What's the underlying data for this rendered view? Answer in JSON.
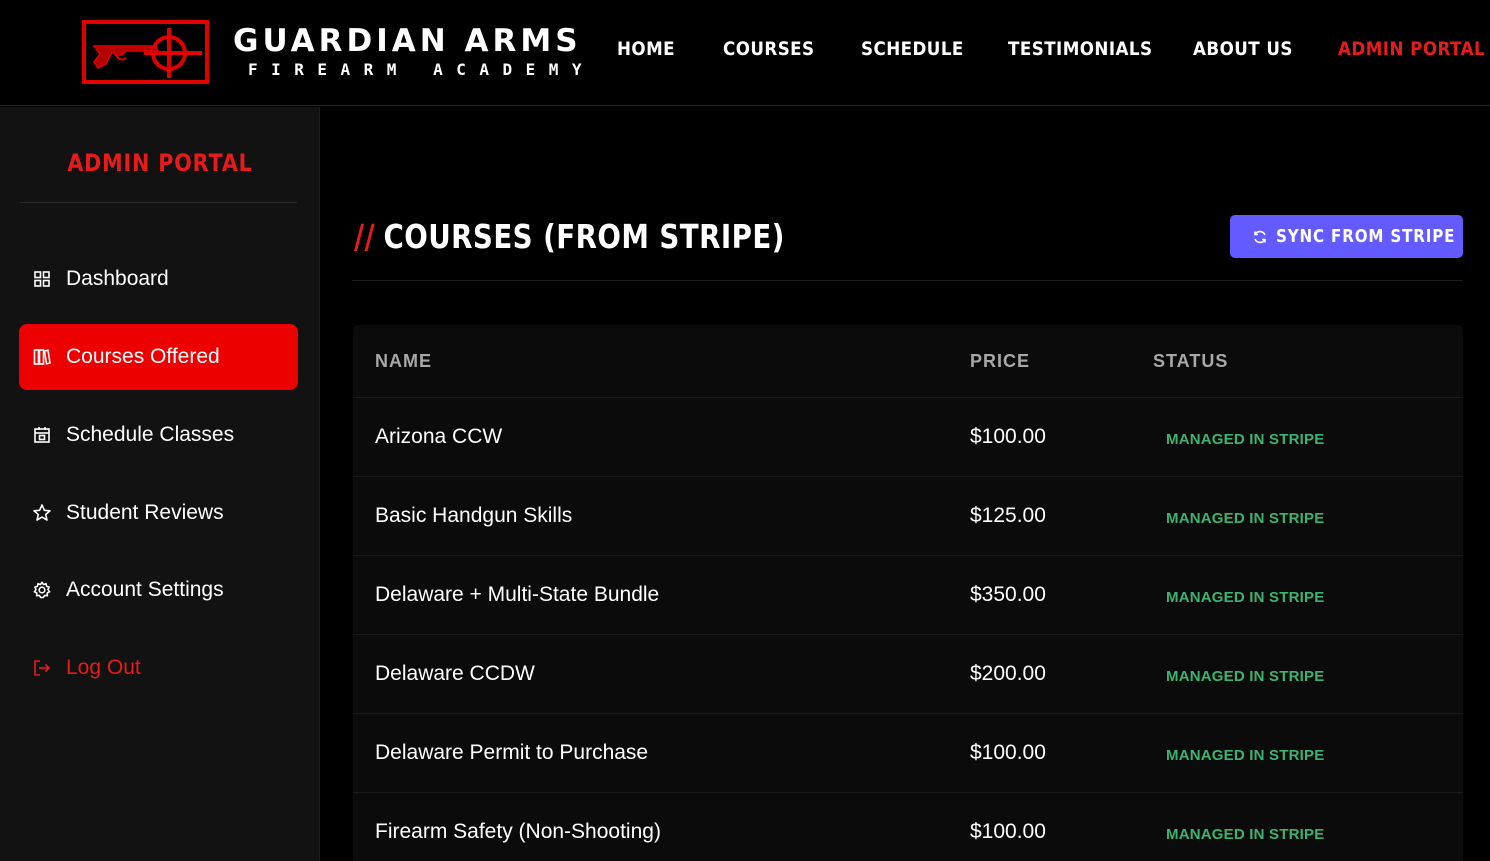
{
  "brand": {
    "title": "GUARDIAN ARMS",
    "subtitle": "FIREARM ACADEMY"
  },
  "nav": {
    "items": [
      "HOME",
      "COURSES",
      "SCHEDULE",
      "TESTIMONIALS",
      "ABOUT US",
      "ADMIN PORTAL"
    ],
    "active": "ADMIN PORTAL"
  },
  "sidebar": {
    "title": "ADMIN PORTAL",
    "items": [
      {
        "label": "Dashboard",
        "icon": "grid-icon"
      },
      {
        "label": "Courses Offered",
        "icon": "book-icon",
        "active": true
      },
      {
        "label": "Schedule Classes",
        "icon": "calendar-icon"
      },
      {
        "label": "Student Reviews",
        "icon": "star-icon"
      },
      {
        "label": "Account Settings",
        "icon": "gear-icon"
      },
      {
        "label": "Log Out",
        "icon": "logout-icon"
      }
    ]
  },
  "main": {
    "title_prefix": "//",
    "title": "COURSES (FROM STRIPE)",
    "sync_button": "SYNC FROM STRIPE",
    "table": {
      "headers": [
        "NAME",
        "PRICE",
        "STATUS"
      ],
      "rows": [
        {
          "name": "Arizona CCW",
          "price": "$100.00",
          "status": "MANAGED IN STRIPE"
        },
        {
          "name": "Basic Handgun Skills",
          "price": "$125.00",
          "status": "MANAGED IN STRIPE"
        },
        {
          "name": "Delaware + Multi-State Bundle",
          "price": "$350.00",
          "status": "MANAGED IN STRIPE"
        },
        {
          "name": "Delaware CCDW",
          "price": "$200.00",
          "status": "MANAGED IN STRIPE"
        },
        {
          "name": "Delaware Permit to Purchase",
          "price": "$100.00",
          "status": "MANAGED IN STRIPE"
        },
        {
          "name": "Firearm Safety (Non-Shooting)",
          "price": "$100.00",
          "status": "MANAGED IN STRIPE"
        }
      ]
    }
  },
  "colors": {
    "accent": "#e81b1b",
    "active_bg": "#ec0000",
    "stripe_button": "#635bff",
    "status_green": "#3cb371",
    "background": "#000000",
    "sidebar_bg": "#121212"
  }
}
